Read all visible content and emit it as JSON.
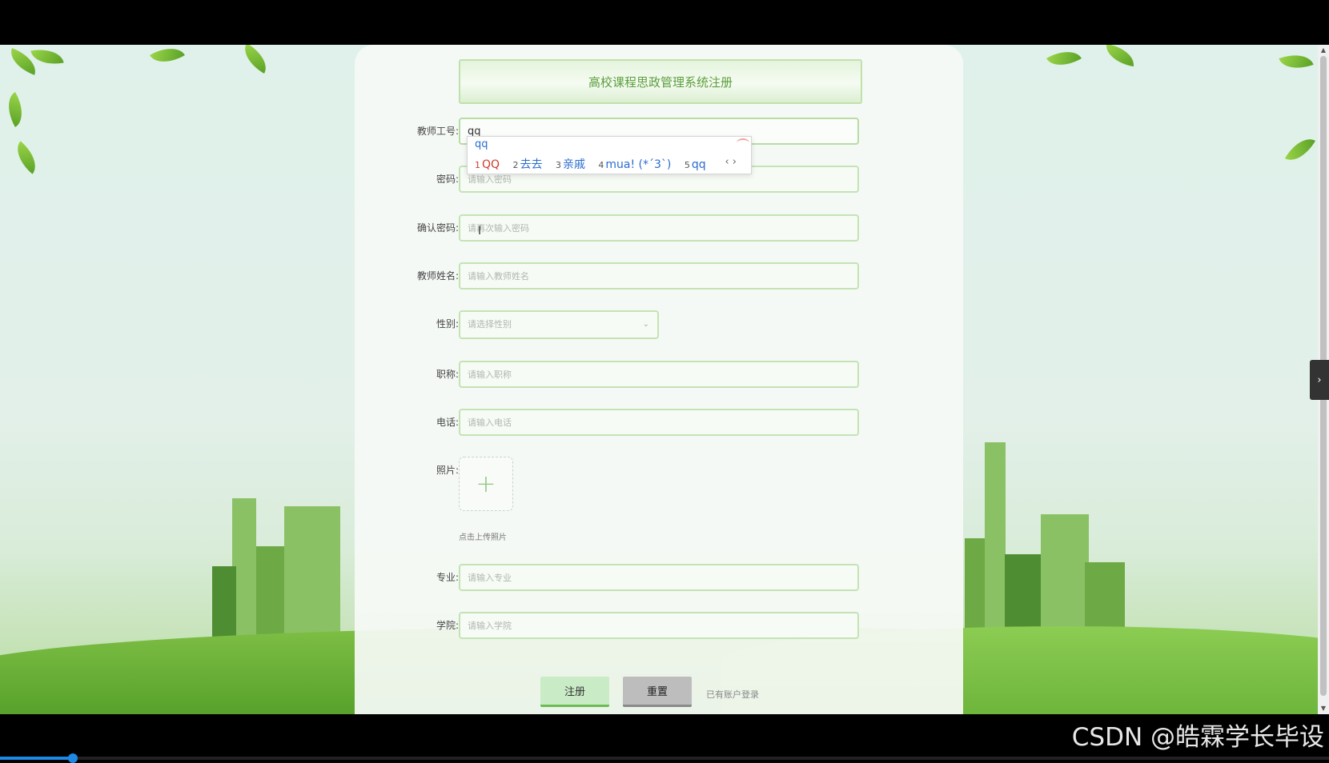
{
  "form": {
    "title": "高校课程思政管理系统注册",
    "fields": [
      {
        "label": "教师工号:",
        "value": "qq",
        "placeholder": ""
      },
      {
        "label": "密码:",
        "value": "",
        "placeholder": "请输入密码"
      },
      {
        "label": "确认密码:",
        "value": "",
        "placeholder": "请再次输入密码"
      },
      {
        "label": "教师姓名:",
        "value": "",
        "placeholder": "请输入教师姓名"
      }
    ],
    "gender": {
      "label": "性别:",
      "placeholder": "请选择性别"
    },
    "fields2": [
      {
        "label": "职称:",
        "value": "",
        "placeholder": "请输入职称"
      },
      {
        "label": "电话:",
        "value": "",
        "placeholder": "请输入电话"
      }
    ],
    "photo": {
      "label": "照片:",
      "tip": "点击上传照片",
      "plus": "+"
    },
    "fields3": [
      {
        "label": "专业:",
        "value": "",
        "placeholder": "请输入专业"
      },
      {
        "label": "学院:",
        "value": "",
        "placeholder": "请输入学院"
      }
    ],
    "buttons": {
      "register": "注册",
      "reset": "重置"
    },
    "login_link": "已有账户登录"
  },
  "ime": {
    "composition": "qq",
    "candidates": [
      {
        "n": "1",
        "text": "QQ"
      },
      {
        "n": "2",
        "text": "去去"
      },
      {
        "n": "3",
        "text": "亲戚"
      },
      {
        "n": "4",
        "text": "mua! (*´3`)"
      },
      {
        "n": "5",
        "text": "qq"
      }
    ],
    "arrows": "‹ ›"
  },
  "watermark": "CSDN @皓霖学长毕设",
  "video_progress": 0.055,
  "colors": {
    "accent_green": "#6cbc52",
    "title_green": "#5a9e3a",
    "input_border": "#c4e3b4"
  }
}
